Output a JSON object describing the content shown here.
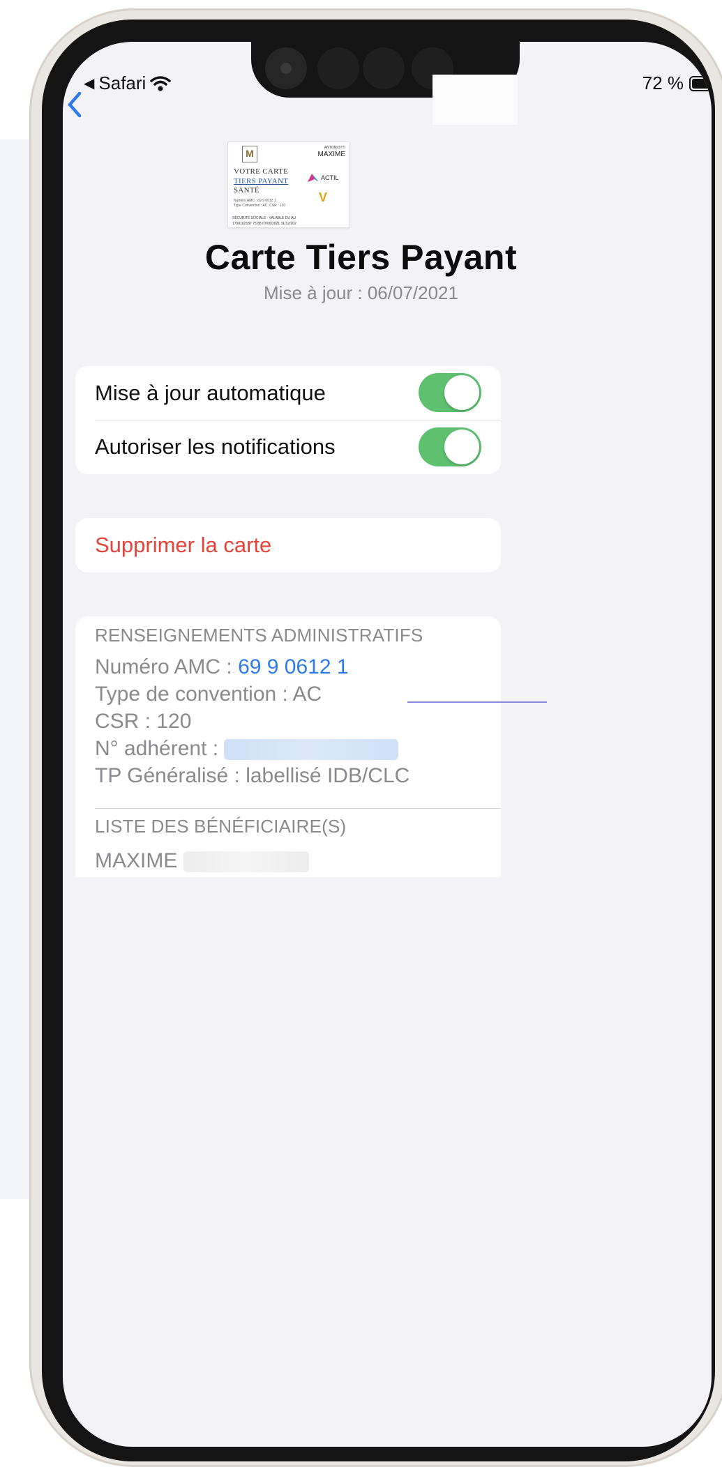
{
  "status_bar": {
    "back_app": "Safari",
    "battery": "72 %",
    "battery_level": 0.72
  },
  "card_image": {
    "holder_small": "ANTONIOTTI",
    "holder_name": "MAXIME",
    "line1": "VOTRE CARTE",
    "line2": "TIERS PAYANT",
    "line3": "SANTÉ",
    "numero": "Numéro AMC : 69 9 0612 1",
    "convention": "Type Convention : AC, CSR : 120",
    "brand": "ACTIL",
    "foot_labels": "SÉCURITÉ SOCIALE :    VALABLE DU    AU",
    "foot_values": "1700162187 75 88   07/06/2021   31/12/202"
  },
  "header": {
    "title": "Carte Tiers Payant",
    "subtitle": "Mise à jour : 06/07/2021"
  },
  "settings": {
    "auto_update_label": "Mise à jour automatique",
    "auto_update_on": true,
    "notifications_label": "Autoriser les notifications",
    "notifications_on": true
  },
  "actions": {
    "delete_label": "Supprimer la carte"
  },
  "admin": {
    "section_title": "RENSEIGNEMENTS ADMINISTRATIFS",
    "amc_label": "Numéro AMC : ",
    "amc_value": "69 9 0612 1",
    "convention": "Type de convention : AC",
    "csr": "CSR : 120",
    "adherent_label": "N° adhérent : ",
    "tp": "TP Généralisé : labellisé IDB/CLC"
  },
  "beneficiaries": {
    "section_title": "LISTE DES BÉNÉFICIAIRE(S)",
    "first_name": "MAXIME"
  },
  "colors": {
    "accent_blue": "#2f7bea",
    "toggle_green": "#5fc170",
    "destructive_red": "#e5443b"
  }
}
